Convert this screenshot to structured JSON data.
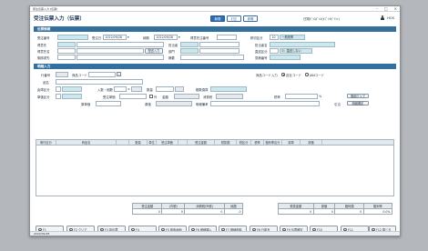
{
  "window": {
    "titlebar_text": "受注伝票入力 [伝票]"
  },
  "header": {
    "title": "受注伝票入力（伝票）",
    "btn_register": "新規",
    "btn_revise": "訂正",
    "btn_refer": "参照",
    "company": "日翔ｶﾞﾗｽﾎﾞﾄﾙ(ｶﾌﾞｼｷｶﾞｲｼｬ)",
    "user": "HOS"
  },
  "section1": {
    "title": "伝票情報",
    "order_no_label": "受注番号",
    "order_date_label": "受注日",
    "order_date_value": "2022/09/28",
    "due_date_label": "納期",
    "due_date_value": "2022/09/28",
    "customer_order_label": "得意先注番号",
    "tax_rate_label": "税切区分",
    "tax_rate_value": "10",
    "tax_kind_value": "一般税率",
    "delivery_label": "得意先名",
    "customer_label": "得意先",
    "bill_to_label": "請求先",
    "invoice_label": "御請求先",
    "sales_rep_label": "担当者",
    "dept_label": "部門",
    "summary_label": "摘要",
    "ship_to_label": "納入先",
    "rep_label": "担当者名",
    "direct_label": "直送区分",
    "direct_value": "0：直送しない",
    "quote_label": "見積番号",
    "detail_btn": "配送入力"
  },
  "section2": {
    "title": "明細入力",
    "row_no_label": "行番号",
    "product_code_label": "商品コード",
    "name_label": "品名",
    "spec_label": "規格",
    "warehouse_label": "倉庫区分",
    "in_out_label": "入数・個数",
    "qty_label": "数量",
    "unit_label": "単位",
    "caseqty_label": "箱数換算",
    "price_kind_label": "単価区分",
    "unit_price_label": "受注単価",
    "ex_label": "外",
    "amount_label": "金額",
    "tax_label": "消費税",
    "price_label": "税率",
    "cost_label": "原単価",
    "cost_amt_label": "原価",
    "note_label": "明細備考",
    "pct_label": "%",
    "code_input_label": "商品コード入力",
    "radio_own": "自社コード",
    "radio_jan": "JANコード",
    "stock_label": "在庫",
    "clear_btn": "明細クリア",
    "update_btn": "明細確定",
    "reserve_label": "引当"
  },
  "grid": {
    "columns": [
      "明行区分",
      "商品名",
      "",
      "数量",
      "単位",
      "受注単価",
      "",
      "受注金額",
      "税抜額",
      "税区分",
      "税率",
      "粗利率区分",
      "原単",
      "原価"
    ]
  },
  "totals1": {
    "headers": [
      "受注金額",
      "(内税)",
      "消費税(外税)",
      "総額"
    ],
    "values": [
      "0",
      "0",
      "0",
      "0"
    ]
  },
  "totals2": {
    "headers": [
      "税抜金額",
      "原価",
      "粗利額",
      "粗利率"
    ],
    "values": [
      "0",
      "0",
      "0",
      "0.0%"
    ]
  },
  "fkeys": [
    "F1",
    "F2 クリア",
    "F3 前伝票",
    "F4",
    "F5 検索画面",
    "F6 明細挿入",
    "F7 明細削除",
    "F8 行複写",
    "F9 伝票確定",
    "F10",
    "F11",
    "F12 閉じる"
  ],
  "status": {
    "date": "2022/09/28"
  }
}
